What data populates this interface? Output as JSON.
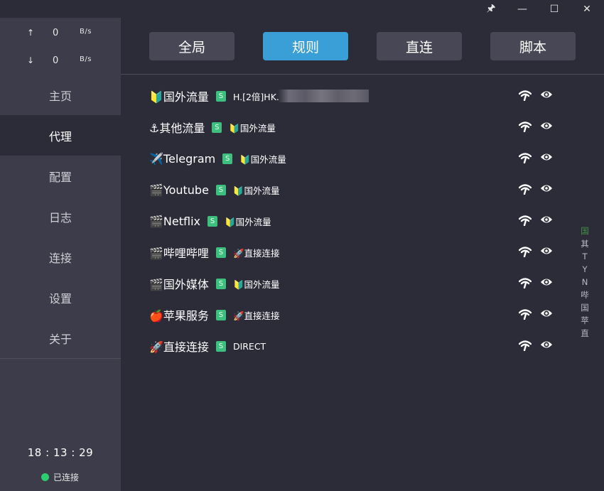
{
  "titlebar": {
    "pin_glyph": "🖈",
    "minimize_glyph": "—",
    "maximize_glyph": "☐",
    "close_glyph": "✕"
  },
  "speed": {
    "up_arrow": "↑",
    "up_value": "0",
    "up_unit": "B/s",
    "down_arrow": "↓",
    "down_value": "0",
    "down_unit": "B/s"
  },
  "nav": {
    "items": [
      {
        "label": "主页"
      },
      {
        "label": "代理"
      },
      {
        "label": "配置"
      },
      {
        "label": "日志"
      },
      {
        "label": "连接"
      },
      {
        "label": "设置"
      },
      {
        "label": "关于"
      }
    ],
    "active": "代理"
  },
  "status": {
    "clock": "18 : 13 : 29",
    "connection": "已连接",
    "connection_color": "#2ecc71"
  },
  "modes": [
    {
      "label": "全局"
    },
    {
      "label": "规则"
    },
    {
      "label": "直连"
    },
    {
      "label": "脚本"
    }
  ],
  "active_mode": "规则",
  "accent_color": "#3a9fd6",
  "proxies": [
    {
      "name": "🔰国外流量",
      "badge": "S",
      "current": "H.[2倍]HK."
    },
    {
      "name": "⚓其他流量",
      "badge": "S",
      "current": "🔰国外流量"
    },
    {
      "name": "✈️Telegram",
      "badge": "S",
      "current": "🔰国外流量"
    },
    {
      "name": "🎬Youtube",
      "badge": "S",
      "current": "🔰国外流量"
    },
    {
      "name": "🎬Netflix",
      "badge": "S",
      "current": "🔰国外流量"
    },
    {
      "name": "🎬哔哩哔哩",
      "badge": "S",
      "current": "🚀直接连接"
    },
    {
      "name": "🎬国外媒体",
      "badge": "S",
      "current": "🔰国外流量"
    },
    {
      "name": "🍎苹果服务",
      "badge": "S",
      "current": "🚀直接连接"
    },
    {
      "name": "🚀直接连接",
      "badge": "S",
      "current": "DIRECT"
    }
  ],
  "side_index": [
    "国",
    "其",
    "T",
    "Y",
    "N",
    "哔",
    "国",
    "苹",
    "直"
  ]
}
